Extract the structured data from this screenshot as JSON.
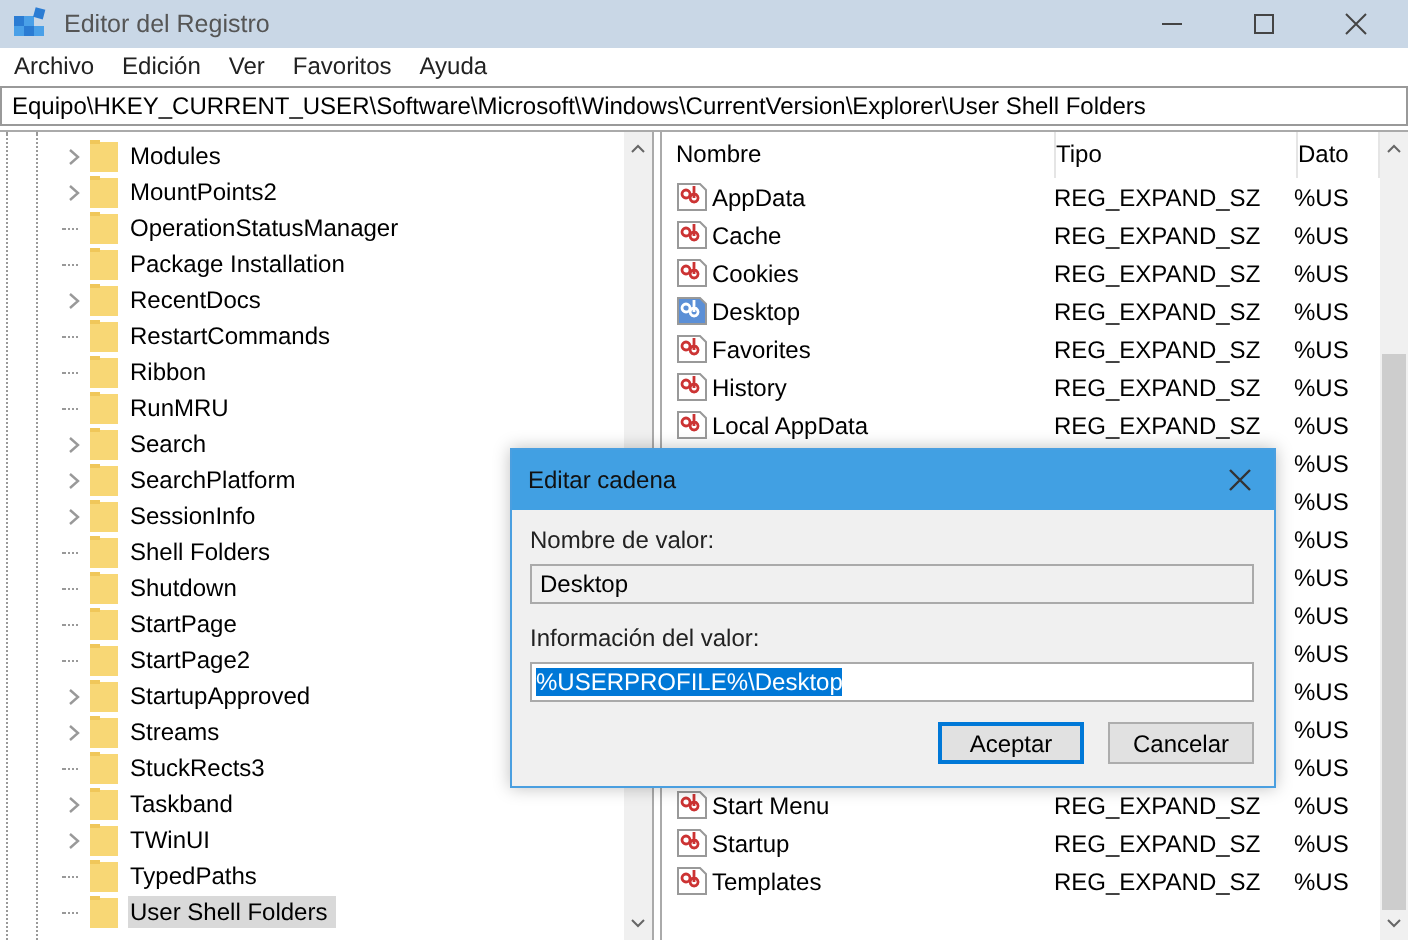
{
  "window": {
    "title": "Editor del Registro"
  },
  "menu": [
    "Archivo",
    "Edición",
    "Ver",
    "Favoritos",
    "Ayuda"
  ],
  "address": "Equipo\\HKEY_CURRENT_USER\\Software\\Microsoft\\Windows\\CurrentVersion\\Explorer\\User Shell Folders",
  "tree": {
    "items": [
      {
        "label": "Modules",
        "expandable": true,
        "selected": false
      },
      {
        "label": "MountPoints2",
        "expandable": true,
        "selected": false
      },
      {
        "label": "OperationStatusManager",
        "expandable": false,
        "selected": false
      },
      {
        "label": "Package Installation",
        "expandable": false,
        "selected": false
      },
      {
        "label": "RecentDocs",
        "expandable": true,
        "selected": false
      },
      {
        "label": "RestartCommands",
        "expandable": false,
        "selected": false
      },
      {
        "label": "Ribbon",
        "expandable": false,
        "selected": false
      },
      {
        "label": "RunMRU",
        "expandable": false,
        "selected": false
      },
      {
        "label": "Search",
        "expandable": true,
        "selected": false
      },
      {
        "label": "SearchPlatform",
        "expandable": true,
        "selected": false
      },
      {
        "label": "SessionInfo",
        "expandable": true,
        "selected": false
      },
      {
        "label": "Shell Folders",
        "expandable": false,
        "selected": false
      },
      {
        "label": "Shutdown",
        "expandable": false,
        "selected": false
      },
      {
        "label": "StartPage",
        "expandable": false,
        "selected": false
      },
      {
        "label": "StartPage2",
        "expandable": false,
        "selected": false
      },
      {
        "label": "StartupApproved",
        "expandable": true,
        "selected": false
      },
      {
        "label": "Streams",
        "expandable": true,
        "selected": false
      },
      {
        "label": "StuckRects3",
        "expandable": false,
        "selected": false
      },
      {
        "label": "Taskband",
        "expandable": true,
        "selected": false
      },
      {
        "label": "TWinUI",
        "expandable": true,
        "selected": false
      },
      {
        "label": "TypedPaths",
        "expandable": false,
        "selected": false
      },
      {
        "label": "User Shell Folders",
        "expandable": false,
        "selected": true
      }
    ]
  },
  "values": {
    "columns": [
      "Nombre",
      "Tipo",
      "Dato"
    ],
    "rows": [
      {
        "name": "AppData",
        "type": "REG_EXPAND_SZ",
        "data": "%US",
        "selected": false
      },
      {
        "name": "Cache",
        "type": "REG_EXPAND_SZ",
        "data": "%US",
        "selected": false
      },
      {
        "name": "Cookies",
        "type": "REG_EXPAND_SZ",
        "data": "%US",
        "selected": false
      },
      {
        "name": "Desktop",
        "type": "REG_EXPAND_SZ",
        "data": "%US",
        "selected": true
      },
      {
        "name": "Favorites",
        "type": "REG_EXPAND_SZ",
        "data": "%US",
        "selected": false
      },
      {
        "name": "History",
        "type": "REG_EXPAND_SZ",
        "data": "%US",
        "selected": false
      },
      {
        "name": "Local AppData",
        "type": "REG_EXPAND_SZ",
        "data": "%US",
        "selected": false
      },
      {
        "data": "%US"
      },
      {
        "data": "%US"
      },
      {
        "data": "%US"
      },
      {
        "data": "%US"
      },
      {
        "data": "%US"
      },
      {
        "data": "%US"
      },
      {
        "data": "%US"
      },
      {
        "data": "%US"
      },
      {
        "data": "%US"
      },
      {
        "name": "Start Menu",
        "type": "REG_EXPAND_SZ",
        "data": "%US",
        "selected": false
      },
      {
        "name": "Startup",
        "type": "REG_EXPAND_SZ",
        "data": "%US",
        "selected": false
      },
      {
        "name": "Templates",
        "type": "REG_EXPAND_SZ",
        "data": "%US",
        "selected": false
      }
    ]
  },
  "dialog": {
    "title": "Editar cadena",
    "name_label": "Nombre de valor:",
    "name_value": "Desktop",
    "data_label": "Información del valor:",
    "data_value": "%USERPROFILE%\\Desktop",
    "buttons": [
      {
        "label": "Aceptar",
        "default": true
      },
      {
        "label": "Cancelar",
        "default": false
      }
    ]
  }
}
